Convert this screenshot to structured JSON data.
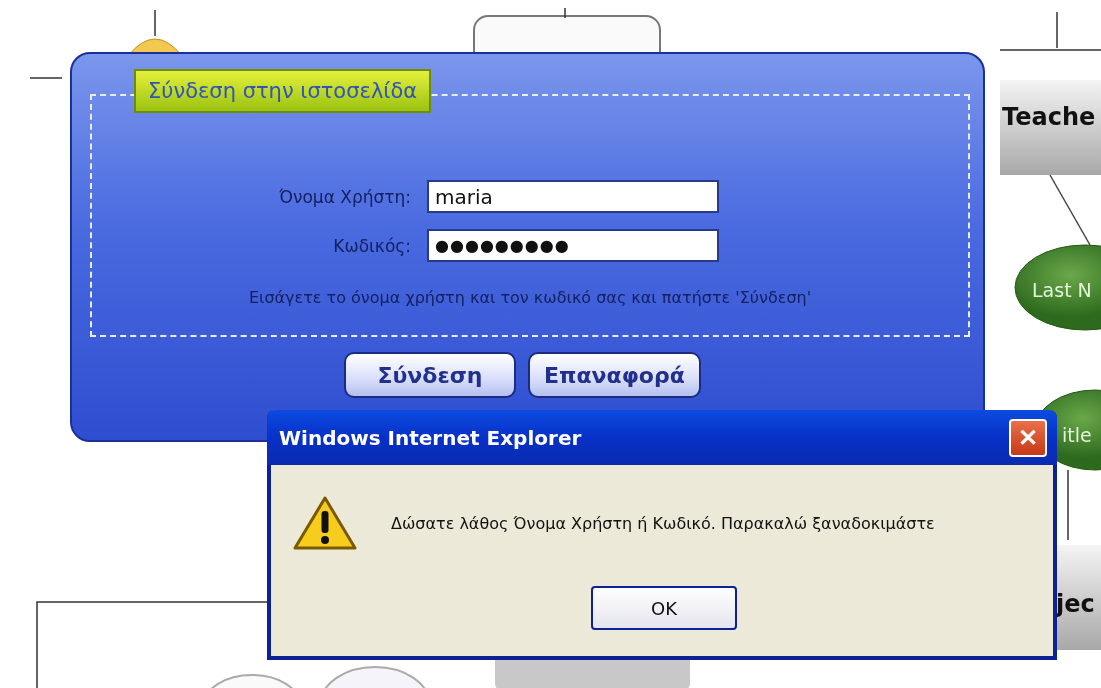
{
  "diagram": {
    "nodes": [
      {
        "kind": "box",
        "label": "Teache"
      },
      {
        "kind": "ellipse",
        "label": "Last N"
      },
      {
        "kind": "ellipse",
        "label": "itle"
      },
      {
        "kind": "box",
        "label": "jec"
      }
    ]
  },
  "login": {
    "title": "Σύνδεση στην ιστοσελίδα",
    "fields": [
      {
        "label": "Όνομα Χρήστη:",
        "value": "maria",
        "kind": "text"
      },
      {
        "label": "Κωδικός:",
        "value": "●●●●●●●●●",
        "kind": "password"
      }
    ],
    "hint": "Εισάγετε το όνομα χρήστη και τον κωδικό σας και πατήστε 'Σύνδεση'",
    "buttons": [
      "Σύνδεση",
      "Επαναφορά"
    ]
  },
  "dialog": {
    "title": "Windows Internet Explorer",
    "close": "✕",
    "message": "Δώσατε λάθος Όνομα Χρήστη ή Κωδικό. Παρακαλώ ξαναδοκιμάστε",
    "buttons": [
      "OK"
    ]
  }
}
